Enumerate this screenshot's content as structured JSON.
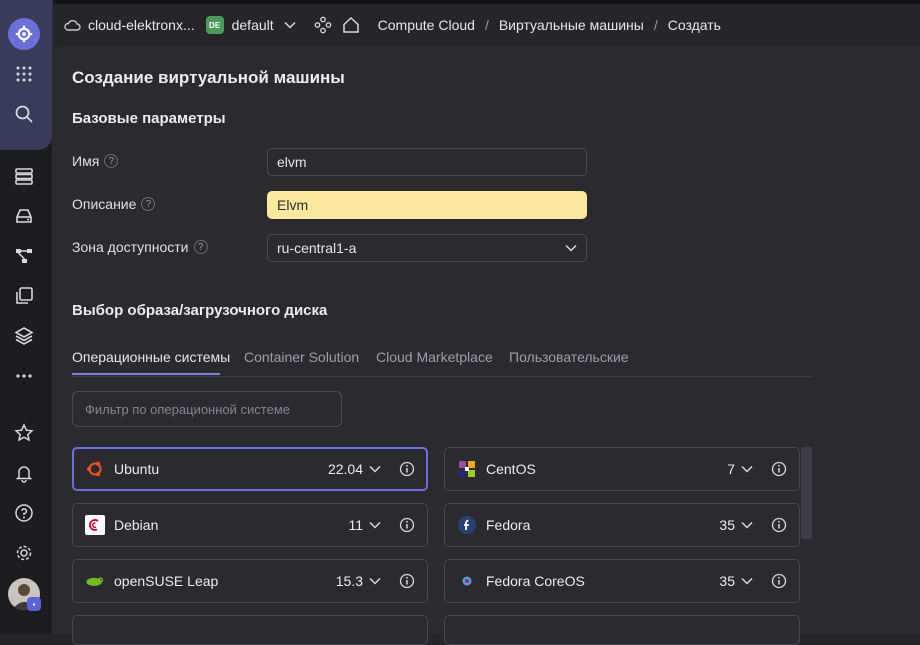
{
  "header": {
    "cloud_name": "cloud-elektronx...",
    "folder_badge": "DE",
    "folder_name": "default",
    "breadcrumbs": [
      "Compute Cloud",
      "Виртуальные машины",
      "Создать"
    ],
    "separator": "/"
  },
  "page": {
    "title": "Создание виртуальной машины",
    "basic_section": "Базовые параметры",
    "fields": {
      "name": {
        "label": "Имя",
        "value": "elvm"
      },
      "description": {
        "label": "Описание",
        "value": "Elvm"
      },
      "zone": {
        "label": "Зона доступности",
        "value": "ru-central1-a"
      }
    },
    "help_glyph": "?",
    "image_section": "Выбор образа/загрузочного диска",
    "tabs": [
      "Операционные системы",
      "Container Solution",
      "Cloud Marketplace",
      "Пользовательские"
    ],
    "filter_placeholder": "Фильтр по операционной системе",
    "os_list": [
      {
        "name": "Ubuntu",
        "version": "22.04",
        "icon": "ubuntu-logo-icon",
        "color": "#e95420"
      },
      {
        "name": "CentOS",
        "version": "7",
        "icon": "centos-logo-icon",
        "color": "#9b4d9b"
      },
      {
        "name": "Debian",
        "version": "11",
        "icon": "debian-logo-icon",
        "color": "#c70036"
      },
      {
        "name": "Fedora",
        "version": "35",
        "icon": "fedora-logo-icon",
        "color": "#294172"
      },
      {
        "name": "openSUSE Leap",
        "version": "15.3",
        "icon": "opensuse-logo-icon",
        "color": "#73ba25"
      },
      {
        "name": "Fedora CoreOS",
        "version": "35",
        "icon": "fedora-coreos-logo-icon",
        "color": "#51a2da"
      }
    ]
  },
  "colors": {
    "accent": "#6a70d8",
    "highlight": "#fbe89f",
    "background": "#2b2b2f"
  }
}
